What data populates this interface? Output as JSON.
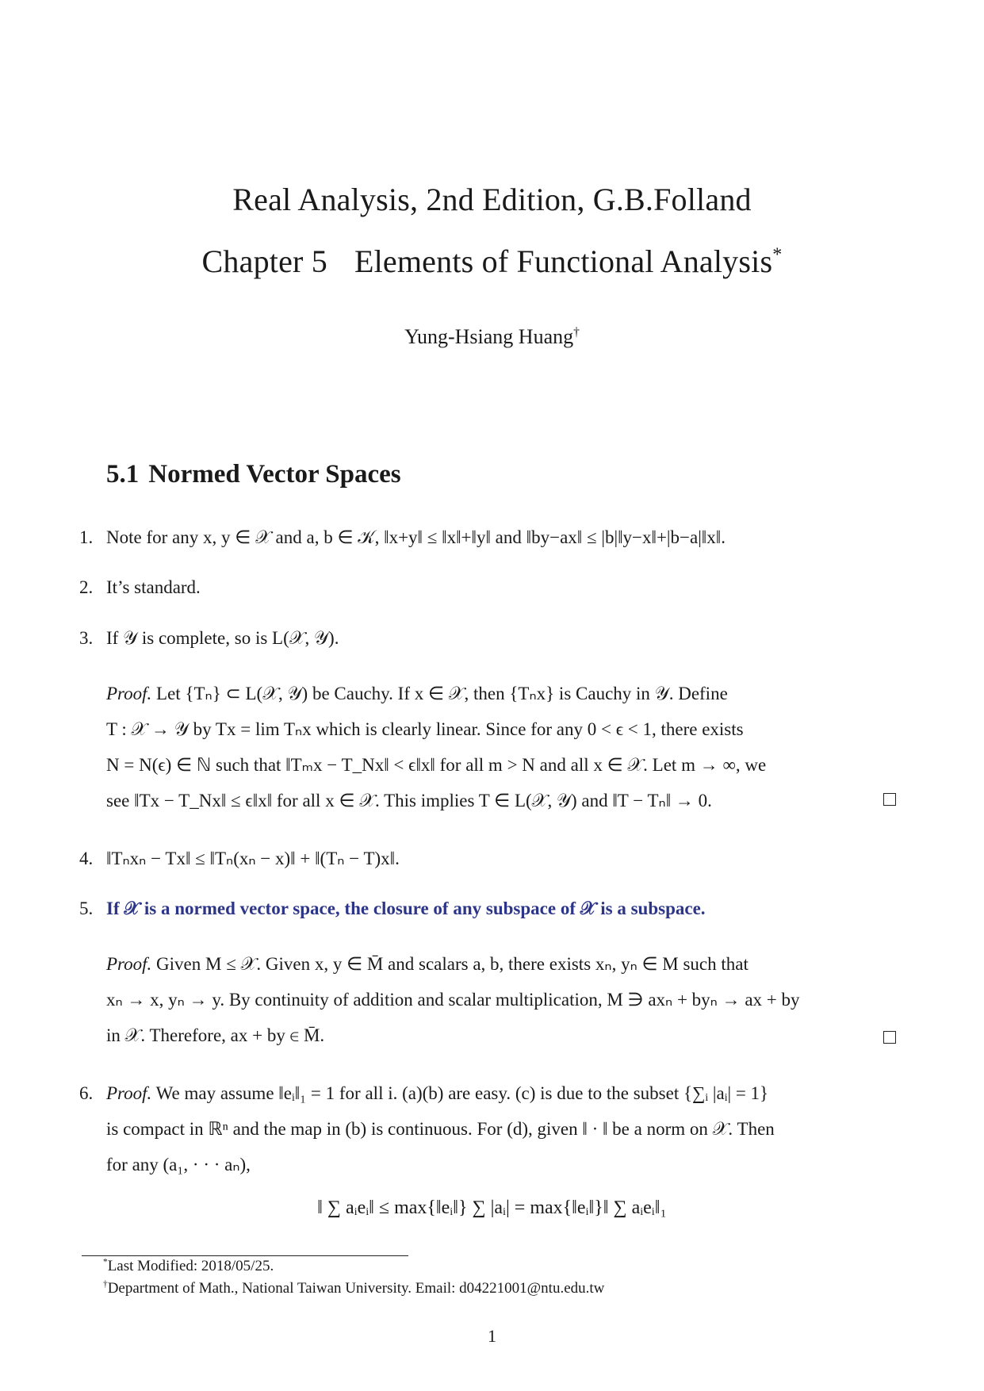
{
  "header": {
    "title_line1": "Real Analysis, 2nd Edition, G.B.Folland",
    "title_line2_chapter": "Chapter 5",
    "title_line2_name": "Elements of Functional Analysis",
    "title_mark": "*",
    "author": "Yung-Hsiang Huang",
    "author_mark": "†"
  },
  "section": {
    "number": "5.1",
    "title": "Normed Vector Spaces"
  },
  "items": [
    {
      "number": "1.",
      "text": "Note for any x, y ∈ 𝒳 and a, b ∈ 𝒦, ‖x+y‖ ≤ ‖x‖+‖y‖ and ‖by−ax‖ ≤ |b|‖y−x‖+|b−a|‖x‖."
    },
    {
      "number": "2.",
      "text": "It’s standard."
    },
    {
      "number": "3.",
      "text": "If 𝒴 is complete, so is L(𝒳, 𝒴)."
    },
    {
      "number": "4.",
      "text": "‖Tₙxₙ − Tx‖ ≤ ‖Tₙ(xₙ − x)‖ + ‖(Tₙ − T)x‖."
    },
    {
      "number": "5.",
      "text": "If 𝒳 is a normed vector space, the closure of any subspace of 𝒳 is a subspace."
    },
    {
      "number": "6.",
      "proof_label": "Proof.",
      "lines": [
        "We may assume ‖eᵢ‖₁ = 1 for all i. (a)(b) are easy. (c) is due to the subset {∑ᵢ |aᵢ| = 1}",
        "is compact in ℝⁿ and the map in (b) is continuous. For (d), given ‖ · ‖ be a norm on 𝒳. Then",
        "for any (a₁, · · · aₙ),"
      ]
    }
  ],
  "proof3": {
    "label": "Proof.",
    "lines": [
      "Let {Tₙ} ⊂ L(𝒳, 𝒴) be Cauchy. If x ∈ 𝒳, then {Tₙx} is Cauchy in 𝒴. Define",
      "T : 𝒳 → 𝒴 by Tx = lim Tₙx which is clearly linear. Since for any 0 < ϵ < 1, there exists",
      "N = N(ϵ) ∈ ℕ such that ‖Tₘx − T_Nx‖ < ϵ‖x‖ for all m > N and all x ∈ 𝒳. Let m → ∞, we",
      "see ‖Tx − T_Nx‖ ≤ ϵ‖x‖ for all x ∈ 𝒳. This implies T ∈ L(𝒳, 𝒴) and ‖T − Tₙ‖ → 0."
    ]
  },
  "proof5": {
    "label": "Proof.",
    "lines": [
      "Given M ≤ 𝒳. Given x, y ∈ M̄ and scalars a, b, there exists xₙ, yₙ ∈ M such that",
      "xₙ → x, yₙ → y. By continuity of addition and scalar multiplication, M ∋ axₙ + byₙ → ax + by",
      "in 𝒳. Therefore, ax + by ∈ M̄."
    ]
  },
  "display_equation": "‖ ∑ aᵢeᵢ‖ ≤ max{‖eᵢ‖} ∑ |aᵢ| = max{‖eᵢ‖}‖ ∑ aᵢeᵢ‖₁",
  "footnotes": [
    {
      "mark": "*",
      "text": "Last Modified: 2018/05/25."
    },
    {
      "mark": "†",
      "text": "Department of Math., National Taiwan University. Email: d04221001@ntu.edu.tw"
    }
  ],
  "page_number": "1",
  "colors": {
    "highlight_text": "#2c3587",
    "body_text": "#1a1a1a"
  }
}
